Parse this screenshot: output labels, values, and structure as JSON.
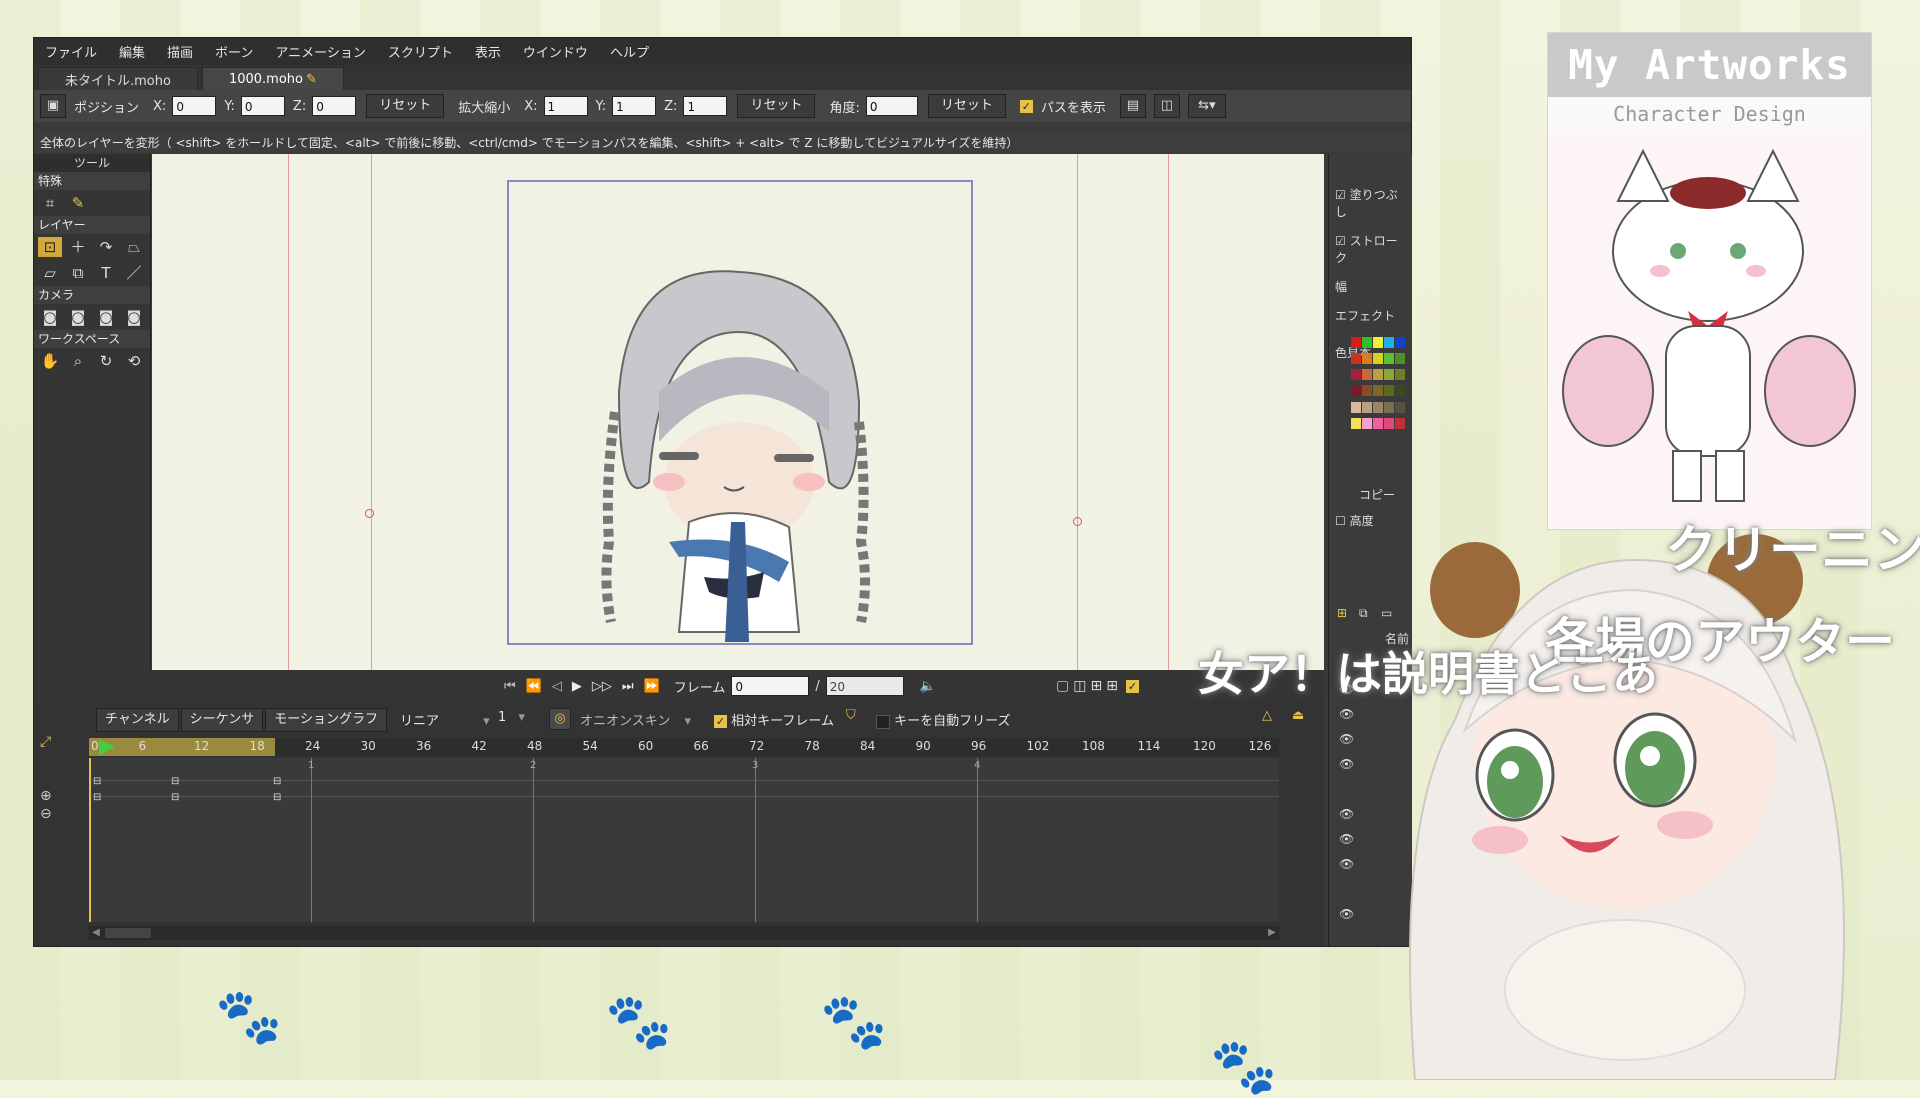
{
  "menu": [
    "ファイル",
    "編集",
    "描画",
    "ボーン",
    "アニメーション",
    "スクリプト",
    "表示",
    "ウインドウ",
    "ヘルプ"
  ],
  "tabs": [
    "未タイトル.moho",
    "1000.moho"
  ],
  "toolopts": {
    "position": "ポジション",
    "x": "X:",
    "y": "Y:",
    "z": "Z:",
    "x_val": "0",
    "y_val": "0",
    "z_val": "0",
    "reset": "リセット",
    "scale": "拡大縮小",
    "sx_val": "1",
    "sy_val": "1",
    "sz_val": "1",
    "angle": "角度:",
    "angle_val": "0",
    "show_path": "パスを表示"
  },
  "status": "全体のレイヤーを変形（ <shift> をホールドして固定、<alt> で前後に移動、<ctrl/cmd> でモーションパスを編集、<shift> + <alt> で Z に移動してビジュアルサイズを維持）",
  "toolbox": {
    "header": "ツール",
    "sections": [
      "特殊",
      "レイヤー",
      "カメラ",
      "ワークスペース"
    ]
  },
  "rightpanel": {
    "fill": "塗りつぶし",
    "stroke": "ストローク",
    "width": "幅",
    "effect": "エフェクト",
    "swatch": "色見本",
    "copy": "コピー",
    "advanced": "高度",
    "name": "名前"
  },
  "swatch_colors": [
    "#e01919",
    "#29c229",
    "#f0f035",
    "#19b4e6",
    "#1540d6",
    "#c8341f",
    "#e07a1f",
    "#d8d21f",
    "#5cc036",
    "#4f8f28",
    "#a81e3c",
    "#c76a3a",
    "#b8a04a",
    "#8aa838",
    "#6f7f28",
    "#7a1a2a",
    "#8a4a2a",
    "#7a6a2a",
    "#5a6a1a",
    "#3a4a1a",
    "#d8b8a0",
    "#b8a080",
    "#988868",
    "#787050",
    "#585040",
    "#f5e05a",
    "#f5a0c8",
    "#f060a0",
    "#e04a7a",
    "#c0303a"
  ],
  "playback": {
    "frame_label": "フレーム",
    "frame_val": "0",
    "total": "20"
  },
  "timeline": {
    "tabs": [
      "チャンネル",
      "シーケンサ",
      "モーショングラフ"
    ],
    "interp": "リニア",
    "interp_val": "1",
    "onion": "オニオンスキン",
    "relative_kf": "相対キーフレーム",
    "auto_freeze": "キーを自動フリーズ",
    "ruler": [
      "0",
      "6",
      "12",
      "18",
      "24",
      "30",
      "36",
      "42",
      "48",
      "54",
      "60",
      "66",
      "72",
      "78",
      "84",
      "90",
      "96",
      "102",
      "108",
      "114",
      "120",
      "126"
    ],
    "seconds": [
      "1",
      "2",
      "3",
      "4"
    ]
  },
  "card": {
    "title": "My Artworks",
    "subtitle": "Character Design"
  },
  "overlay": {
    "line1": "クリーニン",
    "line2": "各場のアウター",
    "line3": "女ア！は説明書とこあ"
  }
}
